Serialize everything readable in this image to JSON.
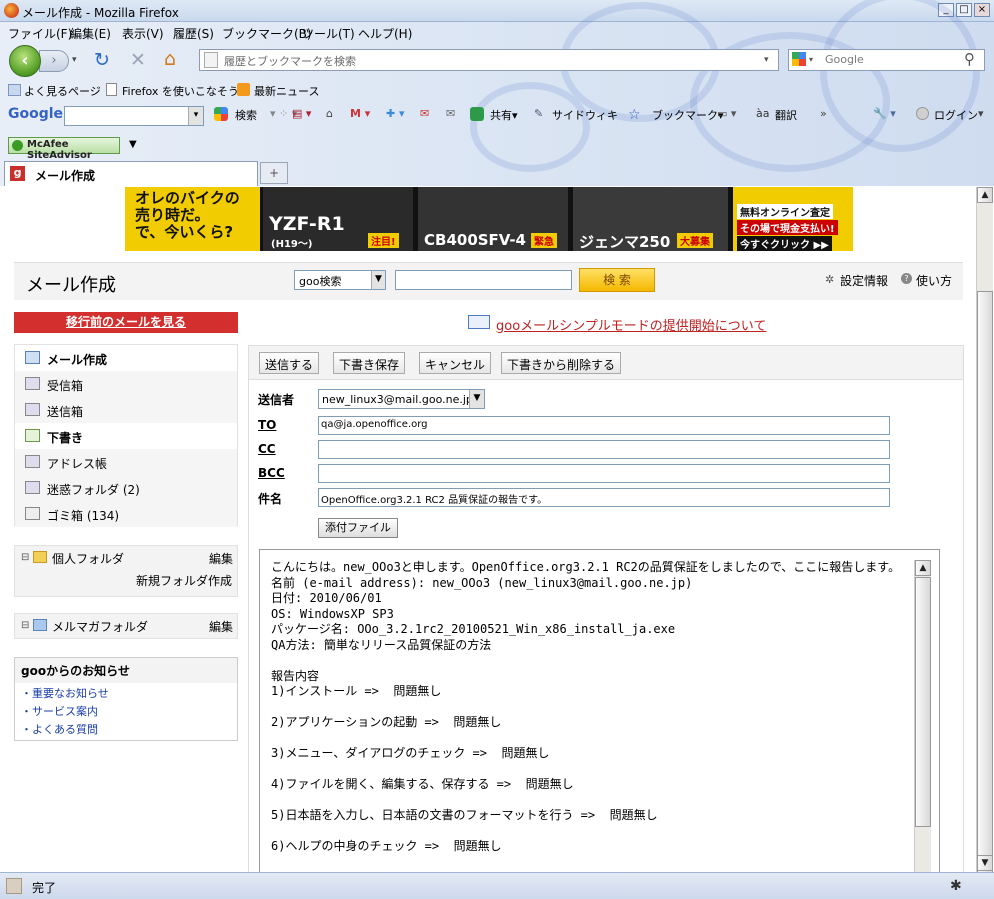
{
  "window": {
    "title": "メール作成 - Mozilla Firefox"
  },
  "menu": [
    "ファイル(F)",
    "編集(E)",
    "表示(V)",
    "履歴(S)",
    "ブックマーク(B)",
    "ツール(T)",
    "ヘルプ(H)"
  ],
  "urlbar": {
    "placeholder": "履歴とブックマークを検索"
  },
  "searchbox": {
    "placeholder": "Google"
  },
  "bookmarks": [
    "よく見るページ",
    "Firefox を使いこなそう",
    "最新ニュース"
  ],
  "google_toolbar": {
    "logo": "Google",
    "search": "検索",
    "share": "共有▾",
    "sidewiki": "サイドウィキ",
    "bookmark": "ブックマーク▾",
    "translate": "翻訳",
    "login": "ログイン"
  },
  "mcafee": "McAfee SiteAdvisor",
  "tab": {
    "label": "メール作成",
    "new_tab": "+"
  },
  "banner": {
    "text1": "オレのバイクの\n売り時だ。\nで、今いくら?",
    "m1": "YZF-R1",
    "m1s": "(H19〜)",
    "m2": "CB400SFV-4",
    "m3": "ジェンマ250",
    "b1": "注目!",
    "b2": "緊急",
    "b3": "大募集",
    "r1": "無料オンライン査定",
    "r2": "その場で現金支払い!",
    "r3": "今すぐクリック ▶▶"
  },
  "header": {
    "page_title": "メール作成",
    "search_select": "goo検索",
    "search_button": "検 索",
    "settings": "設定情報",
    "help": "使い方"
  },
  "old_mail_link": "移行前のメールを見る",
  "pr_link": "gooメールシンプルモードの提供開始について",
  "nav": [
    {
      "label": "メール作成"
    },
    {
      "label": "受信箱"
    },
    {
      "label": "送信箱"
    },
    {
      "label": "下書き"
    },
    {
      "label": "アドレス帳"
    },
    {
      "label": "迷惑フォルダ (2)"
    },
    {
      "label": "ゴミ箱 (134)"
    }
  ],
  "personal_folder": {
    "title": "個人フォルダ",
    "edit": "編集",
    "new_folder": "新規フォルダ作成"
  },
  "magazine_folder": {
    "title": "メルマガフォルダ",
    "edit": "編集"
  },
  "notice": {
    "title": "gooからのお知らせ",
    "links": [
      "・重要なお知らせ",
      "・サービス案内",
      "・よくある質問"
    ]
  },
  "actions": {
    "send": "送信する",
    "save_draft": "下書き保存",
    "cancel": "キャンセル",
    "delete_draft": "下書きから削除する"
  },
  "form": {
    "from_label": "送信者",
    "from_value": "new_linux3@mail.goo.ne.jp",
    "to_label": "TO",
    "to_value": "qa@ja.openoffice.org",
    "cc_label": "CC",
    "cc_value": "",
    "bcc_label": "BCC",
    "bcc_value": "",
    "subject_label": "件名",
    "subject_value": "OpenOffice.org3.2.1 RC2 品質保証の報告です。",
    "attach_label": "添付ファイル"
  },
  "body": "こんにちは。new_OOo3と申します。OpenOffice.org3.2.1 RC2の品質保証をしましたので、ここに報告します。\n名前 (e-mail address): new_OOo3 (new_linux3@mail.goo.ne.jp)\n日付: 2010/06/01\nOS: WindowsXP SP3\nパッケージ名: OOo_3.2.1rc2_20100521_Win_x86_install_ja.exe\nQA方法: 簡単なリリース品質保証の方法\n\n報告内容\n1)インストール =>  問題無し\n\n2)アプリケーションの起動 =>  問題無し\n\n3)メニュー、ダイアログのチェック =>  問題無し\n\n4)ファイルを開く、編集する、保存する =>  問題無し\n\n5)日本語を入力し、日本語の文書のフォーマットを行う =>  問題無し\n\n6)ヘルプの中身のチェック =>  問題無し",
  "status": "完了"
}
